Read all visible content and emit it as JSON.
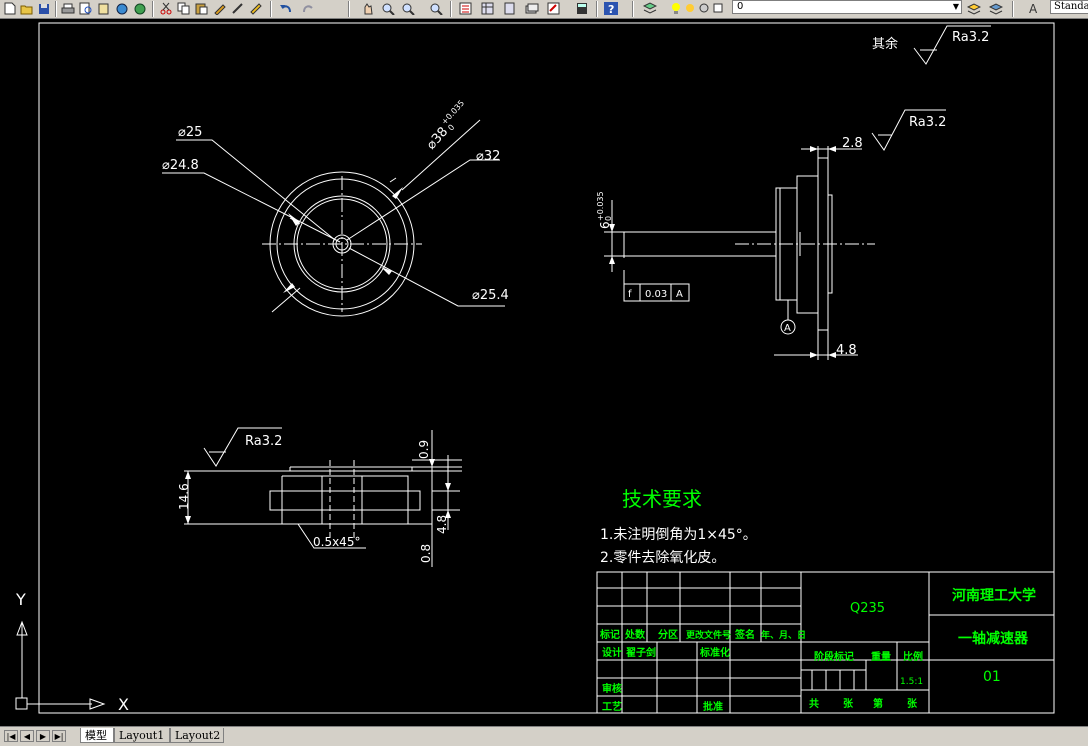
{
  "toolbar": {
    "layer_value": "0",
    "text_style_value": "Standard",
    "icons": [
      "new-icon",
      "open-icon",
      "save-icon",
      "plot-icon",
      "preview-icon",
      "publish-icon",
      "3d-dwf-icon",
      "cut-icon",
      "copy-icon",
      "paste-icon",
      "match-properties-icon",
      "block-editor-icon",
      "undo-icon",
      "redo-icon",
      "pan-icon",
      "zoom-realtime-icon",
      "zoom-window-icon",
      "zoom-previous-icon",
      "properties-icon",
      "design-center-icon",
      "tool-palettes-icon",
      "sheet-set-icon",
      "markup-icon",
      "calculator-icon",
      "help-icon",
      "layer-manager-icon"
    ]
  },
  "drawing": {
    "roughness_note": {
      "label": "其余",
      "value": "Ra3.2"
    },
    "front_view": {
      "dims": [
        "⌀25",
        "⌀24.8",
        "⌀32",
        "⌀25.4"
      ],
      "d38_base": "⌀38",
      "d38_tol_up": "+0.035",
      "d38_tol_low": "0"
    },
    "side_view": {
      "roughness": "Ra3.2",
      "dim_top": "2.8",
      "dim_bottom": "4.8",
      "dia_base": "6",
      "dia_tol_up": "+0.035",
      "dia_tol_low": "0",
      "tolerance_frame": [
        "f",
        "0.03",
        "A"
      ],
      "datum": "A"
    },
    "section_view": {
      "roughness": "Ra3.2",
      "dim_width": "14.6",
      "dim_09": "0.9",
      "dim_48": "4.8",
      "dim_08": "0.8",
      "chamfer": "0.5x45°"
    },
    "tech_requirements": {
      "title": "技术要求",
      "items": [
        "1.未注明倒角为1×45°。",
        "2.零件去除氧化皮。"
      ]
    },
    "title_block": {
      "material": "Q235",
      "university": "河南理工大学",
      "part_name": "一轴减速器",
      "drawing_no": "01",
      "headers": [
        "标记",
        "处数",
        "分区",
        "更改文件号",
        "签名",
        "年、月、日"
      ],
      "design_label": "设计",
      "designer": "翟子剑",
      "standard_label": "标准化",
      "stage_label": "阶段标记",
      "weight_label": "重量",
      "scale_label": "比例",
      "scale_value": "1.5:1",
      "review_label": "审核",
      "process_label": "工艺",
      "approve_label": "批准",
      "sheets": [
        "共",
        "张",
        "第",
        "张"
      ]
    },
    "ucs": {
      "x_label": "X",
      "y_label": "Y"
    }
  },
  "tabs": {
    "items": [
      "模型",
      "Layout1",
      "Layout2"
    ],
    "active": "模型"
  },
  "colors": {
    "background": "#000000",
    "lines": "#ffffff",
    "annotation_text": "#00ff00",
    "chrome": "#d4d0c8"
  }
}
